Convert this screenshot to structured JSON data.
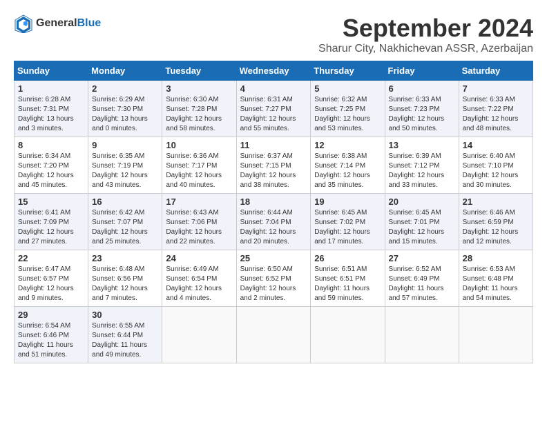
{
  "logo": {
    "general": "General",
    "blue": "Blue"
  },
  "header": {
    "month": "September 2024",
    "location": "Sharur City, Nakhichevan ASSR, Azerbaijan"
  },
  "weekdays": [
    "Sunday",
    "Monday",
    "Tuesday",
    "Wednesday",
    "Thursday",
    "Friday",
    "Saturday"
  ],
  "weeks": [
    [
      {
        "day": "1",
        "sunrise": "6:28 AM",
        "sunset": "7:31 PM",
        "daylight": "13 hours and 3 minutes."
      },
      {
        "day": "2",
        "sunrise": "6:29 AM",
        "sunset": "7:30 PM",
        "daylight": "13 hours and 0 minutes."
      },
      {
        "day": "3",
        "sunrise": "6:30 AM",
        "sunset": "7:28 PM",
        "daylight": "12 hours and 58 minutes."
      },
      {
        "day": "4",
        "sunrise": "6:31 AM",
        "sunset": "7:27 PM",
        "daylight": "12 hours and 55 minutes."
      },
      {
        "day": "5",
        "sunrise": "6:32 AM",
        "sunset": "7:25 PM",
        "daylight": "12 hours and 53 minutes."
      },
      {
        "day": "6",
        "sunrise": "6:33 AM",
        "sunset": "7:23 PM",
        "daylight": "12 hours and 50 minutes."
      },
      {
        "day": "7",
        "sunrise": "6:33 AM",
        "sunset": "7:22 PM",
        "daylight": "12 hours and 48 minutes."
      }
    ],
    [
      {
        "day": "8",
        "sunrise": "6:34 AM",
        "sunset": "7:20 PM",
        "daylight": "12 hours and 45 minutes."
      },
      {
        "day": "9",
        "sunrise": "6:35 AM",
        "sunset": "7:19 PM",
        "daylight": "12 hours and 43 minutes."
      },
      {
        "day": "10",
        "sunrise": "6:36 AM",
        "sunset": "7:17 PM",
        "daylight": "12 hours and 40 minutes."
      },
      {
        "day": "11",
        "sunrise": "6:37 AM",
        "sunset": "7:15 PM",
        "daylight": "12 hours and 38 minutes."
      },
      {
        "day": "12",
        "sunrise": "6:38 AM",
        "sunset": "7:14 PM",
        "daylight": "12 hours and 35 minutes."
      },
      {
        "day": "13",
        "sunrise": "6:39 AM",
        "sunset": "7:12 PM",
        "daylight": "12 hours and 33 minutes."
      },
      {
        "day": "14",
        "sunrise": "6:40 AM",
        "sunset": "7:10 PM",
        "daylight": "12 hours and 30 minutes."
      }
    ],
    [
      {
        "day": "15",
        "sunrise": "6:41 AM",
        "sunset": "7:09 PM",
        "daylight": "12 hours and 27 minutes."
      },
      {
        "day": "16",
        "sunrise": "6:42 AM",
        "sunset": "7:07 PM",
        "daylight": "12 hours and 25 minutes."
      },
      {
        "day": "17",
        "sunrise": "6:43 AM",
        "sunset": "7:06 PM",
        "daylight": "12 hours and 22 minutes."
      },
      {
        "day": "18",
        "sunrise": "6:44 AM",
        "sunset": "7:04 PM",
        "daylight": "12 hours and 20 minutes."
      },
      {
        "day": "19",
        "sunrise": "6:45 AM",
        "sunset": "7:02 PM",
        "daylight": "12 hours and 17 minutes."
      },
      {
        "day": "20",
        "sunrise": "6:45 AM",
        "sunset": "7:01 PM",
        "daylight": "12 hours and 15 minutes."
      },
      {
        "day": "21",
        "sunrise": "6:46 AM",
        "sunset": "6:59 PM",
        "daylight": "12 hours and 12 minutes."
      }
    ],
    [
      {
        "day": "22",
        "sunrise": "6:47 AM",
        "sunset": "6:57 PM",
        "daylight": "12 hours and 9 minutes."
      },
      {
        "day": "23",
        "sunrise": "6:48 AM",
        "sunset": "6:56 PM",
        "daylight": "12 hours and 7 minutes."
      },
      {
        "day": "24",
        "sunrise": "6:49 AM",
        "sunset": "6:54 PM",
        "daylight": "12 hours and 4 minutes."
      },
      {
        "day": "25",
        "sunrise": "6:50 AM",
        "sunset": "6:52 PM",
        "daylight": "12 hours and 2 minutes."
      },
      {
        "day": "26",
        "sunrise": "6:51 AM",
        "sunset": "6:51 PM",
        "daylight": "11 hours and 59 minutes."
      },
      {
        "day": "27",
        "sunrise": "6:52 AM",
        "sunset": "6:49 PM",
        "daylight": "11 hours and 57 minutes."
      },
      {
        "day": "28",
        "sunrise": "6:53 AM",
        "sunset": "6:48 PM",
        "daylight": "11 hours and 54 minutes."
      }
    ],
    [
      {
        "day": "29",
        "sunrise": "6:54 AM",
        "sunset": "6:46 PM",
        "daylight": "11 hours and 51 minutes."
      },
      {
        "day": "30",
        "sunrise": "6:55 AM",
        "sunset": "6:44 PM",
        "daylight": "11 hours and 49 minutes."
      },
      null,
      null,
      null,
      null,
      null
    ]
  ]
}
